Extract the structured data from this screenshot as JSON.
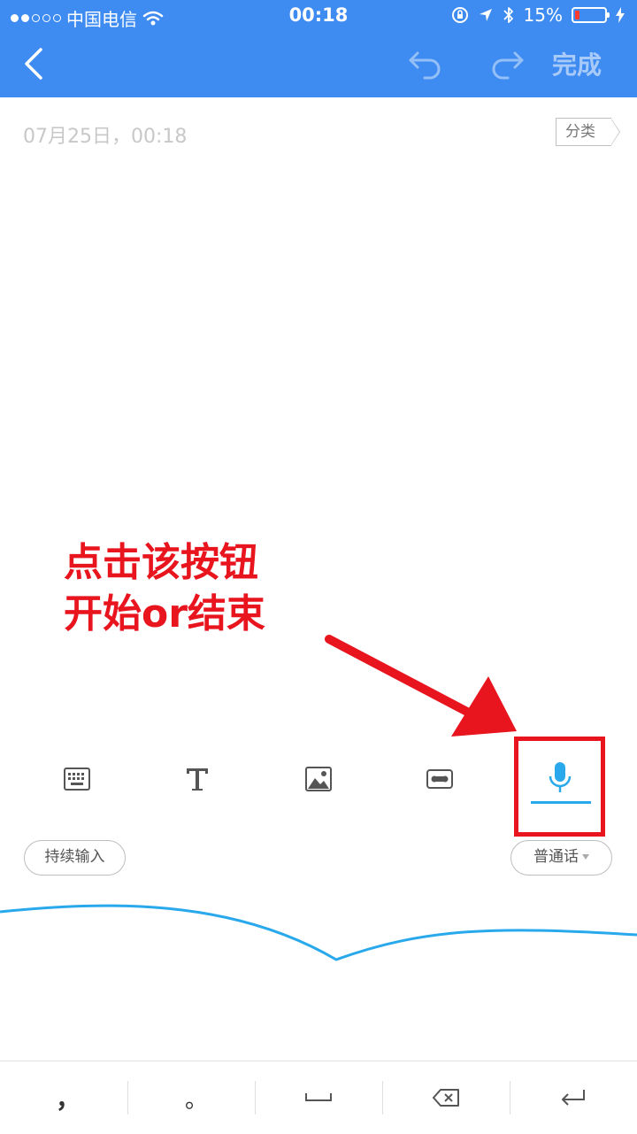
{
  "status_bar": {
    "carrier": "中国电信",
    "time": "00:18",
    "battery_percent": "15%",
    "battery_level": 0.15
  },
  "nav": {
    "done_label": "完成"
  },
  "note": {
    "datetime": "07月25日，00:18",
    "category_label": "分类"
  },
  "annotation": {
    "line1": "点击该按钮",
    "line2": "开始or结束"
  },
  "toolbar": {
    "icons": [
      "keyboard-icon",
      "text-format-icon",
      "image-icon",
      "voice-memo-icon",
      "microphone-icon"
    ]
  },
  "voice": {
    "continuous_label": "持续输入",
    "language_label": "普通话"
  },
  "keys": {
    "comma": "，",
    "period": "。"
  },
  "colors": {
    "nav_bg": "#3e8bf2",
    "accent": "#29a9ec",
    "annotation": "#e8141e"
  }
}
